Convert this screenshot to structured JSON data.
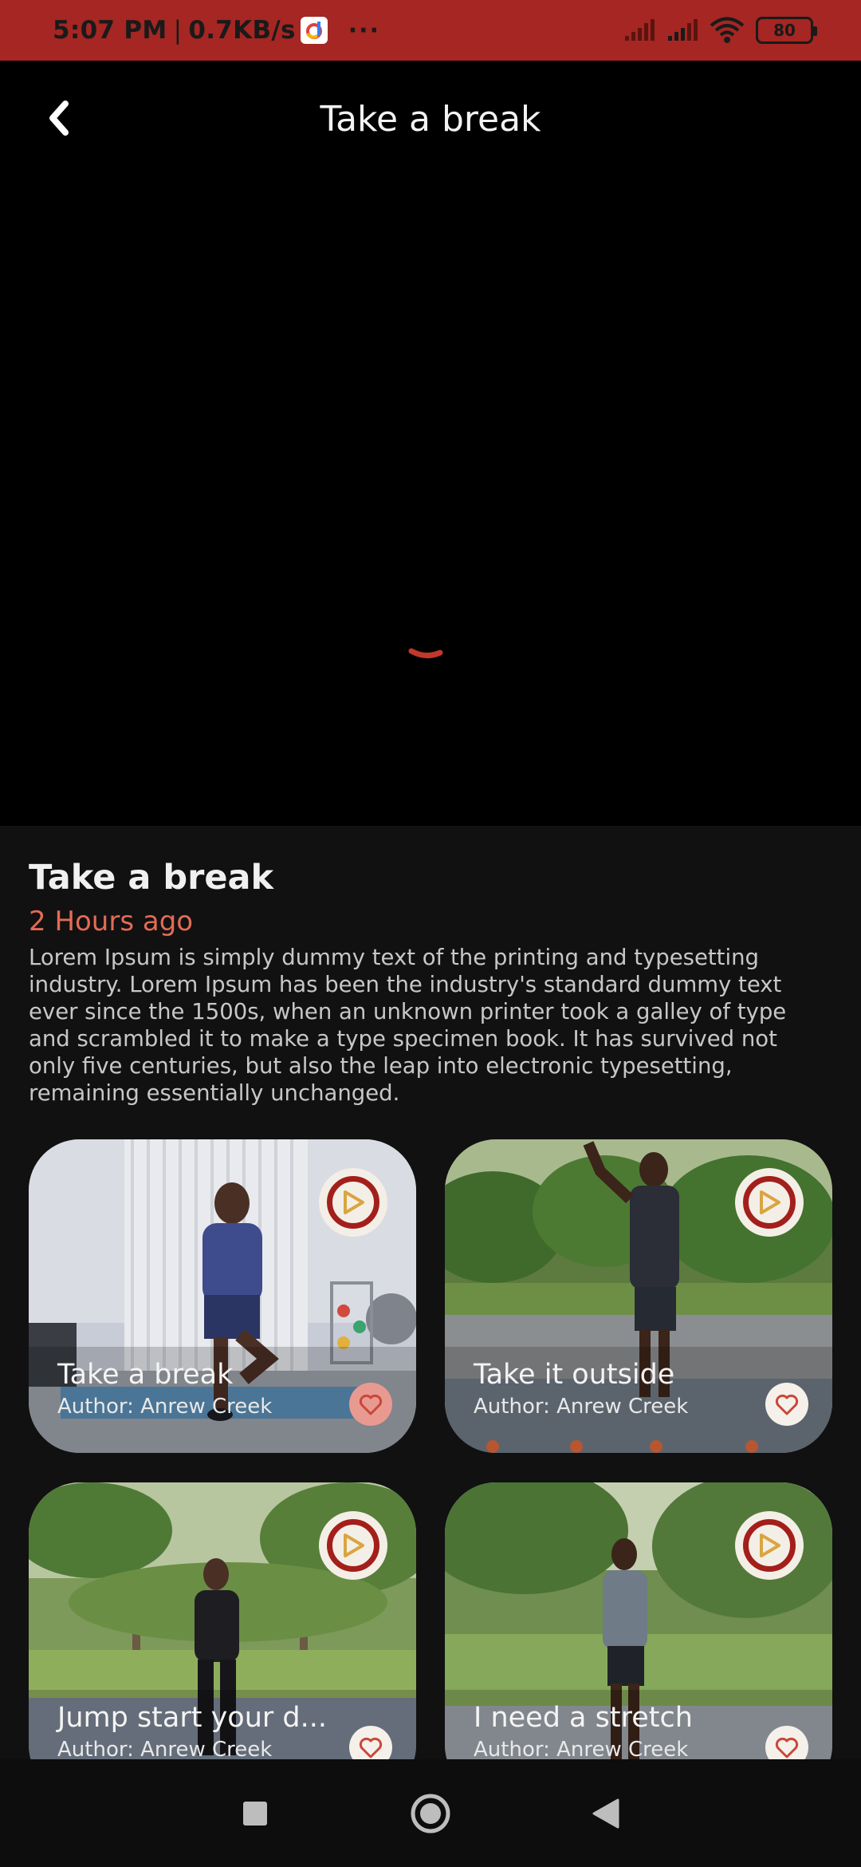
{
  "status_bar": {
    "time": "5:07 PM",
    "separator": "|",
    "speed": "0.7KB/s",
    "more": "···",
    "battery": "80",
    "bar_color": "#a52622"
  },
  "header": {
    "title": "Take a break",
    "back_icon": "chevron-left-icon"
  },
  "player": {
    "loading_indicator": "spinner-icon",
    "accent": "#c0392b"
  },
  "detail": {
    "title": "Take a break",
    "time_ago": "2 Hours ago",
    "time_color": "#e46b55",
    "description": "Lorem Ipsum is simply dummy text of the printing and typesetting industry. Lorem Ipsum has been the industry's standard dummy text ever since the 1500s, when an unknown printer took a galley of type and scrambled it to make a type specimen book. It has survived not only five centuries, but also the leap into electronic typesetting, remaining essentially unchanged."
  },
  "cards": [
    {
      "title": "Take a break",
      "author": "Author: Anrew Creek",
      "favorited": true
    },
    {
      "title": "Take it outside",
      "author": "Author: Anrew Creek",
      "favorited": false
    },
    {
      "title": "Jump start your d...",
      "author": "Author: Anrew Creek",
      "favorited": false
    },
    {
      "title": "I need a stretch",
      "author": "Author: Anrew Creek",
      "favorited": false
    }
  ],
  "nav": {
    "recents": "square-icon",
    "home": "circle-icon",
    "back": "triangle-back-icon"
  }
}
